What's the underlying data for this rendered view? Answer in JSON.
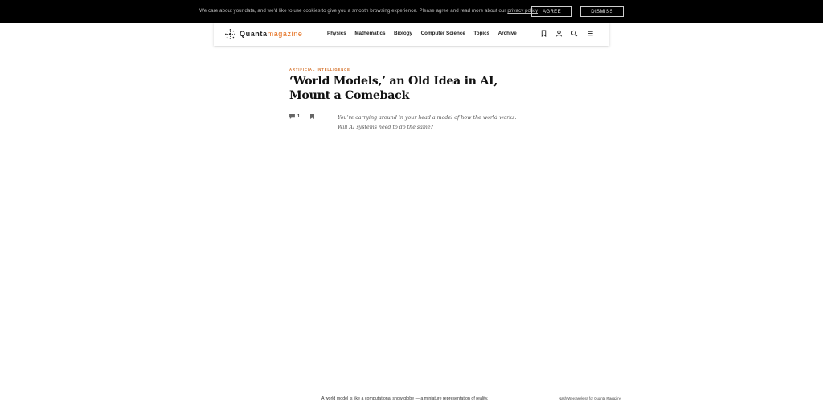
{
  "cookie_banner": {
    "text": "We care about your data, and we'd like to use cookies to give you a smooth browsing experience. Please agree and read more about our",
    "policy_link": "privacy policy",
    "agree_label": "AGREE",
    "dismiss_label": "DISMISS"
  },
  "header": {
    "logo_part1": "Quanta",
    "logo_part2": "magazine",
    "nav": [
      "Physics",
      "Mathematics",
      "Biology",
      "Computer Science",
      "Topics",
      "Archive"
    ],
    "icons": [
      "bookmark-icon",
      "user-icon",
      "search-icon",
      "menu-icon"
    ]
  },
  "article": {
    "kicker": "ARTIFICIAL INTELLIGENCE",
    "title": "‘World Models,’ an Old Idea in AI, Mount a Comeback",
    "comment_count": "1",
    "dek": "You’re carrying around in your head a model of how the world works. Will AI systems need to do the same?"
  },
  "figure": {
    "caption": "A world model is like a computational snow globe — a miniature representation of reality.",
    "credit": "Nash Weerasekera for Quanta Magazine"
  },
  "colors": {
    "accent": "#e46c19",
    "banner_bg": "#000000"
  }
}
